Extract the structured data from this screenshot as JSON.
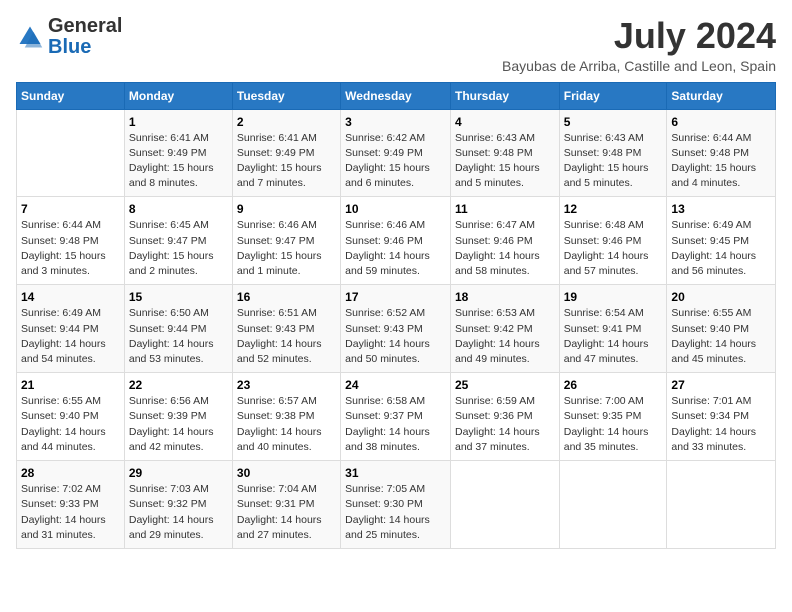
{
  "logo": {
    "general": "General",
    "blue": "Blue"
  },
  "header": {
    "month_year": "July 2024",
    "location": "Bayubas de Arriba, Castille and Leon, Spain"
  },
  "weekdays": [
    "Sunday",
    "Monday",
    "Tuesday",
    "Wednesday",
    "Thursday",
    "Friday",
    "Saturday"
  ],
  "weeks": [
    [
      {
        "day": "",
        "info": ""
      },
      {
        "day": "1",
        "info": "Sunrise: 6:41 AM\nSunset: 9:49 PM\nDaylight: 15 hours\nand 8 minutes."
      },
      {
        "day": "2",
        "info": "Sunrise: 6:41 AM\nSunset: 9:49 PM\nDaylight: 15 hours\nand 7 minutes."
      },
      {
        "day": "3",
        "info": "Sunrise: 6:42 AM\nSunset: 9:49 PM\nDaylight: 15 hours\nand 6 minutes."
      },
      {
        "day": "4",
        "info": "Sunrise: 6:43 AM\nSunset: 9:48 PM\nDaylight: 15 hours\nand 5 minutes."
      },
      {
        "day": "5",
        "info": "Sunrise: 6:43 AM\nSunset: 9:48 PM\nDaylight: 15 hours\nand 5 minutes."
      },
      {
        "day": "6",
        "info": "Sunrise: 6:44 AM\nSunset: 9:48 PM\nDaylight: 15 hours\nand 4 minutes."
      }
    ],
    [
      {
        "day": "7",
        "info": "Sunrise: 6:44 AM\nSunset: 9:48 PM\nDaylight: 15 hours\nand 3 minutes."
      },
      {
        "day": "8",
        "info": "Sunrise: 6:45 AM\nSunset: 9:47 PM\nDaylight: 15 hours\nand 2 minutes."
      },
      {
        "day": "9",
        "info": "Sunrise: 6:46 AM\nSunset: 9:47 PM\nDaylight: 15 hours\nand 1 minute."
      },
      {
        "day": "10",
        "info": "Sunrise: 6:46 AM\nSunset: 9:46 PM\nDaylight: 14 hours\nand 59 minutes."
      },
      {
        "day": "11",
        "info": "Sunrise: 6:47 AM\nSunset: 9:46 PM\nDaylight: 14 hours\nand 58 minutes."
      },
      {
        "day": "12",
        "info": "Sunrise: 6:48 AM\nSunset: 9:46 PM\nDaylight: 14 hours\nand 57 minutes."
      },
      {
        "day": "13",
        "info": "Sunrise: 6:49 AM\nSunset: 9:45 PM\nDaylight: 14 hours\nand 56 minutes."
      }
    ],
    [
      {
        "day": "14",
        "info": "Sunrise: 6:49 AM\nSunset: 9:44 PM\nDaylight: 14 hours\nand 54 minutes."
      },
      {
        "day": "15",
        "info": "Sunrise: 6:50 AM\nSunset: 9:44 PM\nDaylight: 14 hours\nand 53 minutes."
      },
      {
        "day": "16",
        "info": "Sunrise: 6:51 AM\nSunset: 9:43 PM\nDaylight: 14 hours\nand 52 minutes."
      },
      {
        "day": "17",
        "info": "Sunrise: 6:52 AM\nSunset: 9:43 PM\nDaylight: 14 hours\nand 50 minutes."
      },
      {
        "day": "18",
        "info": "Sunrise: 6:53 AM\nSunset: 9:42 PM\nDaylight: 14 hours\nand 49 minutes."
      },
      {
        "day": "19",
        "info": "Sunrise: 6:54 AM\nSunset: 9:41 PM\nDaylight: 14 hours\nand 47 minutes."
      },
      {
        "day": "20",
        "info": "Sunrise: 6:55 AM\nSunset: 9:40 PM\nDaylight: 14 hours\nand 45 minutes."
      }
    ],
    [
      {
        "day": "21",
        "info": "Sunrise: 6:55 AM\nSunset: 9:40 PM\nDaylight: 14 hours\nand 44 minutes."
      },
      {
        "day": "22",
        "info": "Sunrise: 6:56 AM\nSunset: 9:39 PM\nDaylight: 14 hours\nand 42 minutes."
      },
      {
        "day": "23",
        "info": "Sunrise: 6:57 AM\nSunset: 9:38 PM\nDaylight: 14 hours\nand 40 minutes."
      },
      {
        "day": "24",
        "info": "Sunrise: 6:58 AM\nSunset: 9:37 PM\nDaylight: 14 hours\nand 38 minutes."
      },
      {
        "day": "25",
        "info": "Sunrise: 6:59 AM\nSunset: 9:36 PM\nDaylight: 14 hours\nand 37 minutes."
      },
      {
        "day": "26",
        "info": "Sunrise: 7:00 AM\nSunset: 9:35 PM\nDaylight: 14 hours\nand 35 minutes."
      },
      {
        "day": "27",
        "info": "Sunrise: 7:01 AM\nSunset: 9:34 PM\nDaylight: 14 hours\nand 33 minutes."
      }
    ],
    [
      {
        "day": "28",
        "info": "Sunrise: 7:02 AM\nSunset: 9:33 PM\nDaylight: 14 hours\nand 31 minutes."
      },
      {
        "day": "29",
        "info": "Sunrise: 7:03 AM\nSunset: 9:32 PM\nDaylight: 14 hours\nand 29 minutes."
      },
      {
        "day": "30",
        "info": "Sunrise: 7:04 AM\nSunset: 9:31 PM\nDaylight: 14 hours\nand 27 minutes."
      },
      {
        "day": "31",
        "info": "Sunrise: 7:05 AM\nSunset: 9:30 PM\nDaylight: 14 hours\nand 25 minutes."
      },
      {
        "day": "",
        "info": ""
      },
      {
        "day": "",
        "info": ""
      },
      {
        "day": "",
        "info": ""
      }
    ]
  ]
}
